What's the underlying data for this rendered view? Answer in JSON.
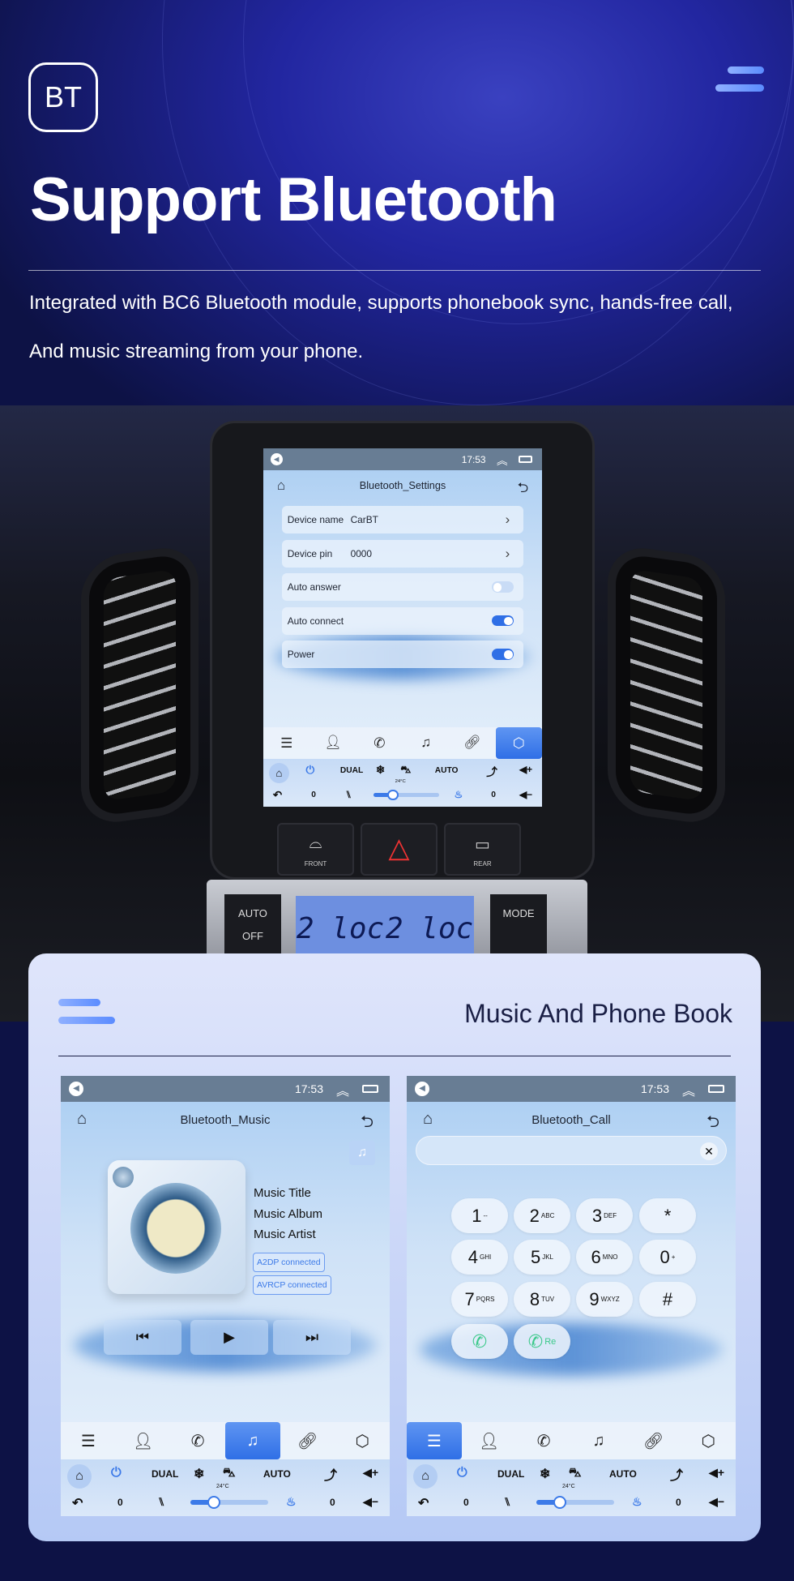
{
  "hero": {
    "badge": "BT",
    "title": "Support Bluetooth",
    "line1": "Integrated with BC6 Bluetooth module, supports phonebook sync, hands-free call,",
    "line2": "And music streaming from your phone.",
    "menu_icon": "hamburger-icon"
  },
  "dashboard": {
    "lcd_left": "2 loc",
    "lcd_right": "2 loc",
    "btn_auto": "AUTO",
    "btn_off": "OFF",
    "btn_mode": "MODE",
    "front_label": "FRONT",
    "rear_label": "REAR"
  },
  "status": {
    "time": "17:53"
  },
  "nav_icons": [
    "apps-icon",
    "contacts-icon",
    "phone-icon",
    "music-icon",
    "link-icon",
    "settings-icon"
  ],
  "climate": {
    "dual": "DUAL",
    "auto": "AUTO",
    "temp": "24°C",
    "left_level": "0",
    "right_level": "0",
    "fan_level": 0.3
  },
  "settings_screen": {
    "title": "Bluetooth_Settings",
    "active_tab": 5,
    "rows": [
      {
        "label": "Device name",
        "value": "CarBT"
      },
      {
        "label": "Device pin",
        "value": "0000"
      },
      {
        "label": "Auto answer",
        "toggle": false
      },
      {
        "label": "Auto connect",
        "toggle": true
      },
      {
        "label": "Power",
        "toggle": true
      }
    ]
  },
  "card": {
    "title": "Music And Phone Book"
  },
  "music_screen": {
    "title": "Bluetooth_Music",
    "active_tab": 3,
    "track_title": "Music Title",
    "album": "Music Album",
    "artist": "Music Artist",
    "a2dp": "A2DP  connected",
    "avrcp": "AVRCP connected"
  },
  "call_screen": {
    "title": "Bluetooth_Call",
    "active_tab": 0,
    "number": "",
    "keys": [
      {
        "d": "1",
        "s": "--"
      },
      {
        "d": "2",
        "s": "ABC"
      },
      {
        "d": "3",
        "s": "DEF"
      },
      {
        "d": "*",
        "s": ""
      },
      {
        "d": "4",
        "s": "GHI"
      },
      {
        "d": "5",
        "s": "JKL"
      },
      {
        "d": "6",
        "s": "MNO"
      },
      {
        "d": "0",
        "s": "+"
      },
      {
        "d": "7",
        "s": "PQRS"
      },
      {
        "d": "8",
        "s": "TUV"
      },
      {
        "d": "9",
        "s": "WXYZ"
      },
      {
        "d": "#",
        "s": ""
      }
    ],
    "redial": "Re",
    "accent": "#3cc98a"
  }
}
